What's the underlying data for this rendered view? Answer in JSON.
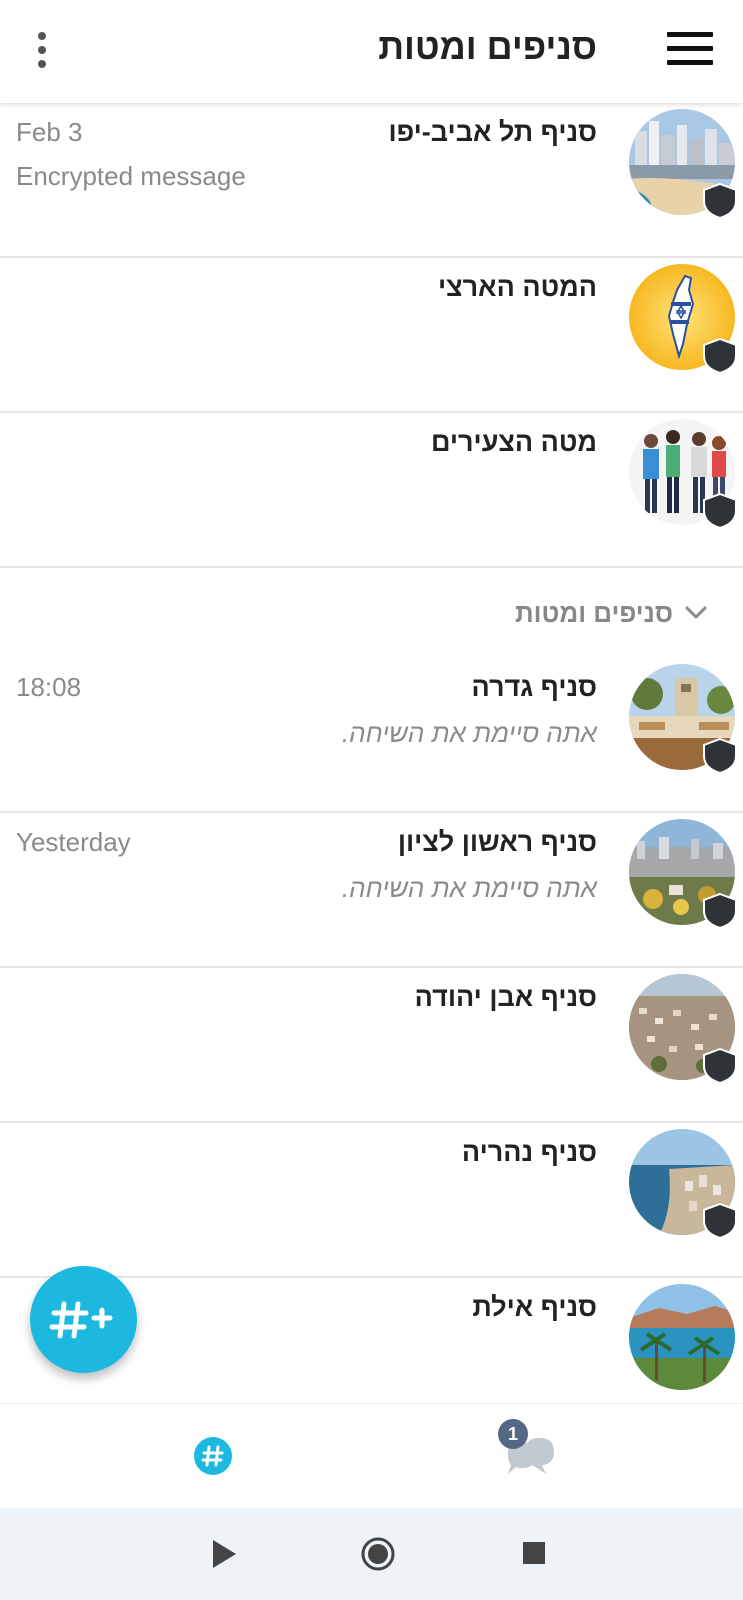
{
  "header": {
    "title": "סניפים ומטות",
    "menu_icon": "hamburger-icon",
    "more_icon": "kebab-icon"
  },
  "pinned": [
    {
      "name": "סניף תל אביב-יפו",
      "time": "Feb 3",
      "preview": "Encrypted message",
      "avatar": "tel-aviv-beach-photo"
    },
    {
      "name": "המטה הארצי",
      "time": "",
      "preview": "",
      "avatar": "israel-map-flag-emblem"
    },
    {
      "name": "מטה הצעירים",
      "time": "",
      "preview": "",
      "avatar": "young-people-illustration"
    }
  ],
  "section": {
    "label": "סניפים ומטות",
    "icon": "chevron-down-icon"
  },
  "branches": [
    {
      "name": "סניף גדרה",
      "time": "18:08",
      "preview": "אתה סיימת את השיחה.",
      "avatar": "gedera-sign-photo"
    },
    {
      "name": "סניף ראשון לציון",
      "time": "Yesterday",
      "preview": "אתה סיימת את השיחה.",
      "avatar": "rishon-lezion-city-photo"
    },
    {
      "name": "סניף אבן יהודה",
      "time": "",
      "preview": "",
      "avatar": "even-yehuda-aerial-photo"
    },
    {
      "name": "סניף נהריה",
      "time": "",
      "preview": "",
      "avatar": "nahariya-coast-photo"
    },
    {
      "name": "סניף אילת",
      "time": "",
      "preview": "",
      "avatar": "eilat-palms-photo"
    }
  ],
  "fab": {
    "icon": "add-channel-icon",
    "label": "#+"
  },
  "tabs": {
    "chats_badge": "1",
    "channels_icon": "hashtag-icon",
    "chats_icon": "chat-bubbles-icon"
  },
  "colors": {
    "accent": "#1cb8df",
    "badge": "#546884",
    "shield": "#2f3338",
    "divider": "#e6e6e6"
  }
}
